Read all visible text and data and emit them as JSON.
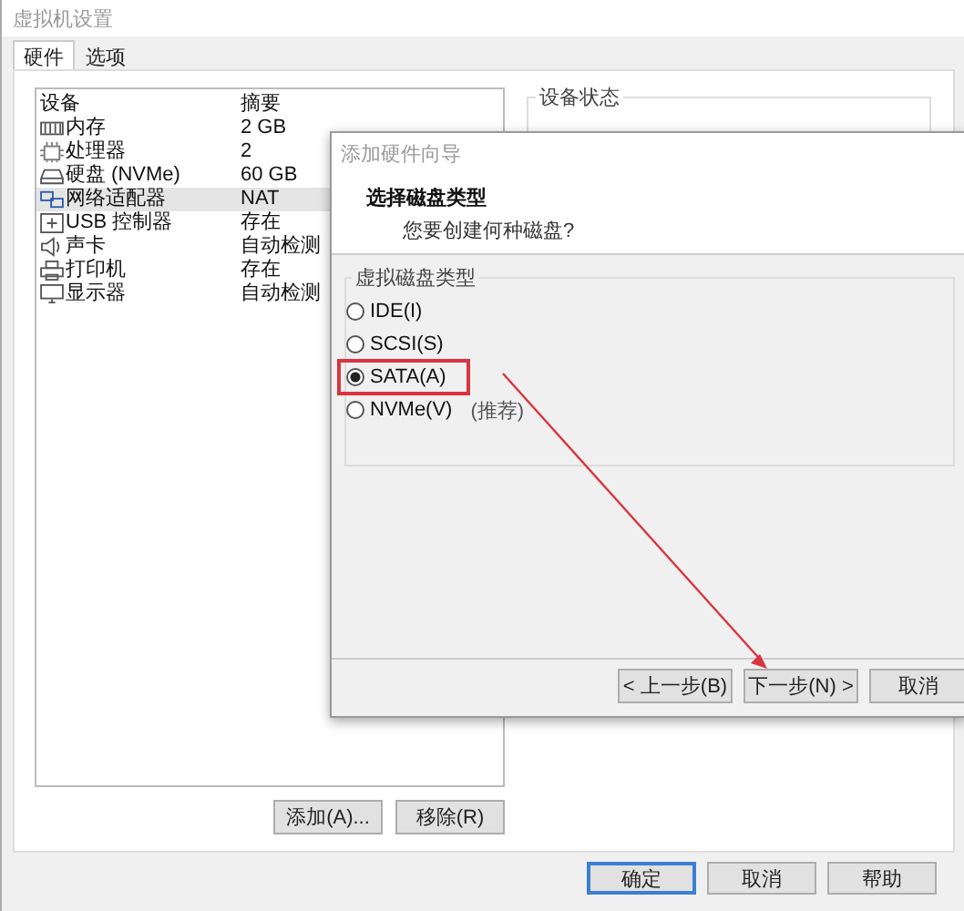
{
  "window": {
    "title": "虚拟机设置"
  },
  "tabs": [
    {
      "label": "硬件",
      "selected": true
    },
    {
      "label": "选项",
      "selected": false
    }
  ],
  "device_list": {
    "columns": [
      "设备",
      "摘要"
    ],
    "rows": [
      {
        "device": "内存",
        "summary": "2 GB",
        "kind": "memory",
        "selected": false
      },
      {
        "device": "处理器",
        "summary": "2",
        "kind": "cpu",
        "selected": false
      },
      {
        "device": "硬盘 (NVMe)",
        "summary": "60 GB",
        "kind": "disk",
        "selected": false
      },
      {
        "device": "网络适配器",
        "summary": "NAT",
        "kind": "network",
        "selected": true
      },
      {
        "device": "USB 控制器",
        "summary": "存在",
        "kind": "usb",
        "selected": false
      },
      {
        "device": "声卡",
        "summary": "自动检测",
        "kind": "sound",
        "selected": false
      },
      {
        "device": "打印机",
        "summary": "存在",
        "kind": "printer",
        "selected": false
      },
      {
        "device": "显示器",
        "summary": "自动检测",
        "kind": "monitor",
        "selected": false
      }
    ]
  },
  "list_buttons": [
    "添加(A)...",
    "移除(R)"
  ],
  "device_status": {
    "title": "设备状态"
  },
  "footer_buttons": [
    {
      "label": "确定",
      "default": true
    },
    {
      "label": "取消",
      "default": false
    },
    {
      "label": "帮助",
      "default": false
    }
  ],
  "wizard": {
    "title": "添加硬件向导",
    "heading": "选择磁盘类型",
    "subheading": "您要创建何种磁盘?",
    "group": "虚拟磁盘类型",
    "options": [
      {
        "label": "IDE(I)",
        "selected": false,
        "highlighted": false
      },
      {
        "label": "SCSI(S)",
        "selected": false,
        "highlighted": false
      },
      {
        "label": "SATA(A)",
        "selected": true,
        "highlighted": true
      },
      {
        "label": "NVMe(V)",
        "selected": false,
        "highlighted": false,
        "note": "(推荐)"
      }
    ],
    "buttons": [
      "< 上一步(B)",
      "下一步(N) >",
      "取消"
    ]
  }
}
